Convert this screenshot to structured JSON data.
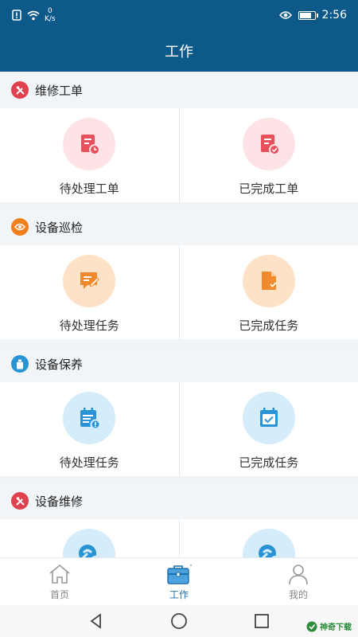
{
  "status_bar": {
    "net_speed_value": "0",
    "net_speed_unit": "K/s",
    "time": "2:56",
    "battery_level": 0.85
  },
  "header": {
    "title": "工作"
  },
  "sections": [
    {
      "title": "维修工单",
      "icon": "tools-icon",
      "accent": "#e0414f",
      "items": [
        {
          "label": "待处理工单",
          "icon": "work-order-pending-icon"
        },
        {
          "label": "已完成工单",
          "icon": "work-order-done-icon"
        }
      ]
    },
    {
      "title": "设备巡检",
      "icon": "eye-icon",
      "accent": "#f07f1e",
      "items": [
        {
          "label": "待处理任务",
          "icon": "inspection-pending-icon"
        },
        {
          "label": "已完成任务",
          "icon": "inspection-done-icon"
        }
      ]
    },
    {
      "title": "设备保养",
      "icon": "bottle-icon",
      "accent": "#2a93d5",
      "items": [
        {
          "label": "待处理任务",
          "icon": "maintenance-pending-icon"
        },
        {
          "label": "已完成任务",
          "icon": "maintenance-done-icon"
        }
      ]
    },
    {
      "title": "设备维修",
      "icon": "tools-icon",
      "accent": "#e0414f",
      "items": [
        {
          "label": "",
          "icon": "repair-pending-icon"
        },
        {
          "label": "",
          "icon": "repair-done-icon"
        }
      ]
    }
  ],
  "tabbar": {
    "tabs": [
      {
        "label": "首页",
        "icon": "home-icon",
        "active": false
      },
      {
        "label": "工作",
        "icon": "briefcase-icon",
        "active": true
      },
      {
        "label": "我的",
        "icon": "user-icon",
        "active": false
      }
    ]
  },
  "watermark": {
    "text": "神奇下载"
  },
  "colors": {
    "primary": "#0d5a8a",
    "tab_active": "#1e6fae",
    "red_bg": "#fde3e5",
    "red": "#e8505b",
    "orange_bg": "#fde2c8",
    "orange": "#f08a2c",
    "blue_bg": "#d5ecfa",
    "blue": "#2a93d5"
  }
}
